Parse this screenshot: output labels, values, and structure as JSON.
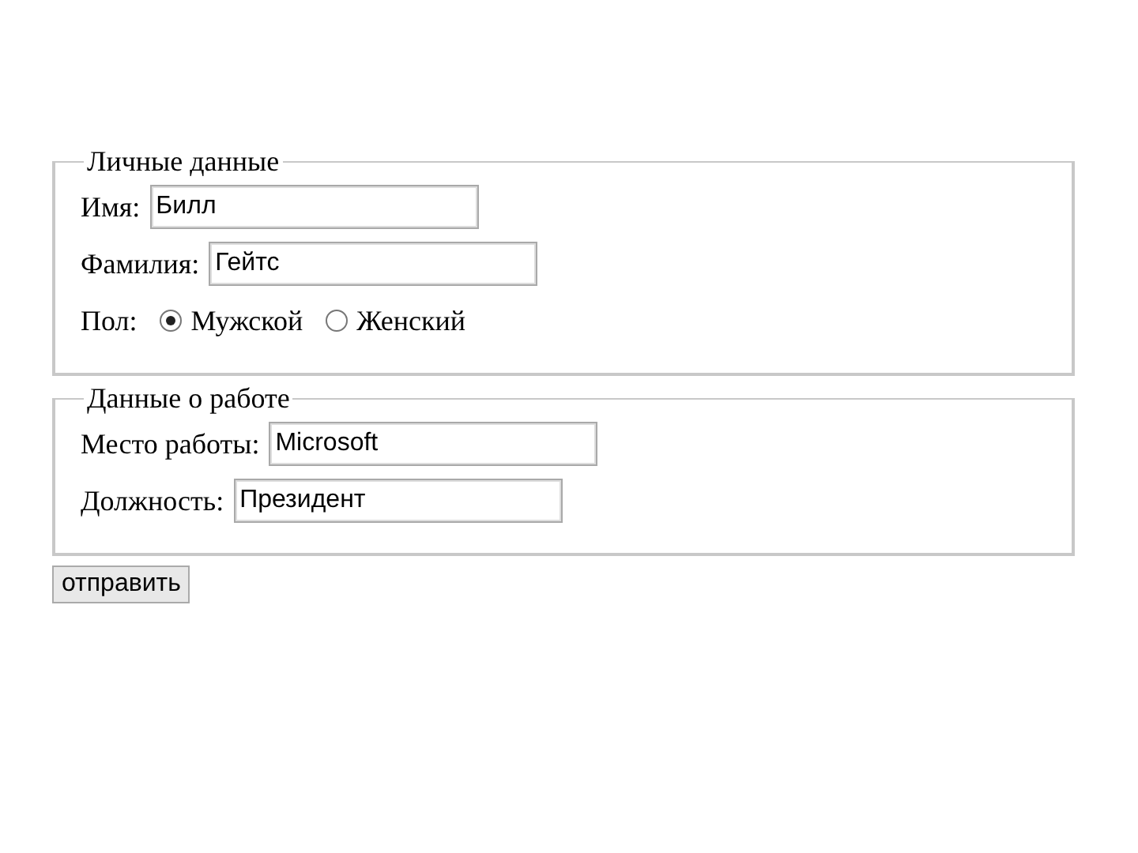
{
  "fieldsets": [
    {
      "legend": "Личные данные",
      "rows": [
        {
          "kind": "text",
          "label": "Имя:",
          "value": "Билл"
        },
        {
          "kind": "text",
          "label": "Фамилия:",
          "value": "Гейтс"
        },
        {
          "kind": "radio",
          "label": "Пол:",
          "options": [
            {
              "label": "Мужской",
              "selected": true
            },
            {
              "label": "Женский",
              "selected": false
            }
          ]
        }
      ]
    },
    {
      "legend": "Данные о работе",
      "rows": [
        {
          "kind": "text",
          "label": "Место работы:",
          "value": "Microsoft"
        },
        {
          "kind": "text",
          "label": "Должность:",
          "value": "Президент"
        }
      ]
    }
  ],
  "submit": "отправить"
}
